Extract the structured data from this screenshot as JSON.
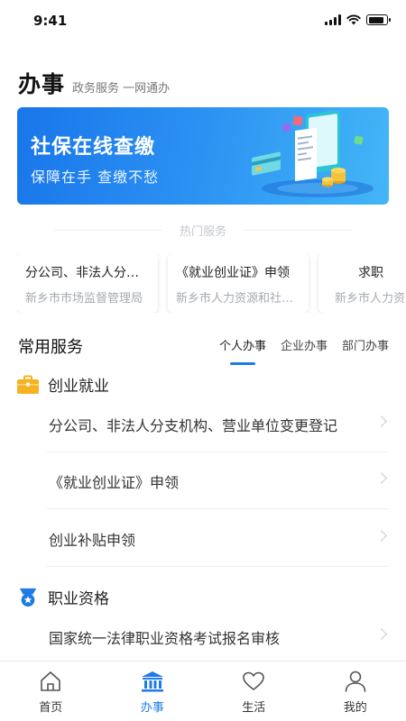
{
  "status_bar": {
    "time": "9:41",
    "battery_level": 0.85
  },
  "header": {
    "title": "办事",
    "subtitle": "政务服务 一网通办"
  },
  "banner": {
    "title": "社保在线查缴",
    "subtitle": "保障在手  查缴不愁"
  },
  "hot_services": {
    "section_title": "热门服务",
    "cards": [
      {
        "title": "分公司、非法人分支机构、营业单位变更登记",
        "org": "新乡市市场监督管理局"
      },
      {
        "title": "《就业创业证》申领",
        "org": "新乡市人力资源和社会保障局"
      },
      {
        "title": "求职",
        "org": "新乡市人力资源和社会保障局"
      }
    ]
  },
  "common_services": {
    "title": "常用服务",
    "tabs": [
      "个人办事",
      "企业办事",
      "部门办事"
    ],
    "active_tab": 0,
    "categories": [
      {
        "name": "创业就业",
        "icon": "briefcase-icon",
        "items": [
          "分公司、非法人分支机构、营业单位变更登记",
          "《就业创业证》申领",
          "创业补贴申领"
        ]
      },
      {
        "name": "职业资格",
        "icon": "medal-icon",
        "items": [
          "国家统一法律职业资格考试报名审核"
        ]
      }
    ]
  },
  "tabbar": {
    "items": [
      {
        "label": "首页",
        "icon": "home-icon"
      },
      {
        "label": "办事",
        "icon": "government-building-icon"
      },
      {
        "label": "生活",
        "icon": "heart-icon"
      },
      {
        "label": "我的",
        "icon": "user-icon"
      }
    ],
    "active": 1
  },
  "colors": {
    "accent": "#1f7ae6",
    "banner_start": "#1976ea",
    "banner_end": "#43b6f7",
    "category_icon": "#f5b324"
  }
}
